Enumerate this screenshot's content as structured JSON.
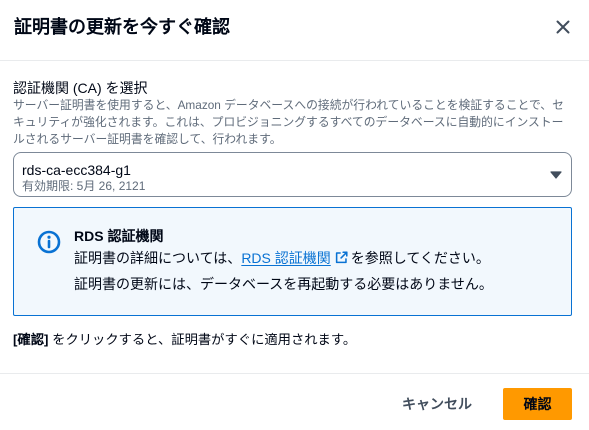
{
  "dialog": {
    "title": "証明書の更新を今すぐ確認",
    "close_icon": "close-icon"
  },
  "ca_field": {
    "label": "認証機関 (CA) を選択",
    "description": "サーバー証明書を使用すると、Amazon データベースへの接続が行われていることを検証することで、セキュリティが強化されます。これは、プロビジョニングするすべてのデータベースに自動的にインストールされるサーバー証明書を確認して、行われます。",
    "select": {
      "value": "rds-ca-ecc384-g1",
      "expiry": "有効期限: 5月 26, 2121",
      "caret_icon": "caret-down-icon"
    }
  },
  "info_alert": {
    "icon": "info-icon",
    "title": "RDS 認証機関",
    "details_prefix": "証明書の詳細については、",
    "link_text": "RDS 認証機関",
    "link_icon": "external-link-icon",
    "details_suffix": "を参照してください。",
    "restart_note": "証明書の更新には、データベースを再起動する必要はありません。"
  },
  "note": {
    "emphasis": "[確認]",
    "text": " をクリックすると、証明書がすぐに適用されます。"
  },
  "footer": {
    "cancel_label": "キャンセル",
    "confirm_label": "確認"
  },
  "colors": {
    "text": "#000716",
    "muted": "#5f6b7a",
    "icon": "#414d5c",
    "divider": "#e9ebed",
    "input_border": "#7d8998",
    "link": "#0972d3",
    "info_border": "#0972d3",
    "info_bg": "#f2f8fd",
    "primary_button": "#ff9900"
  }
}
